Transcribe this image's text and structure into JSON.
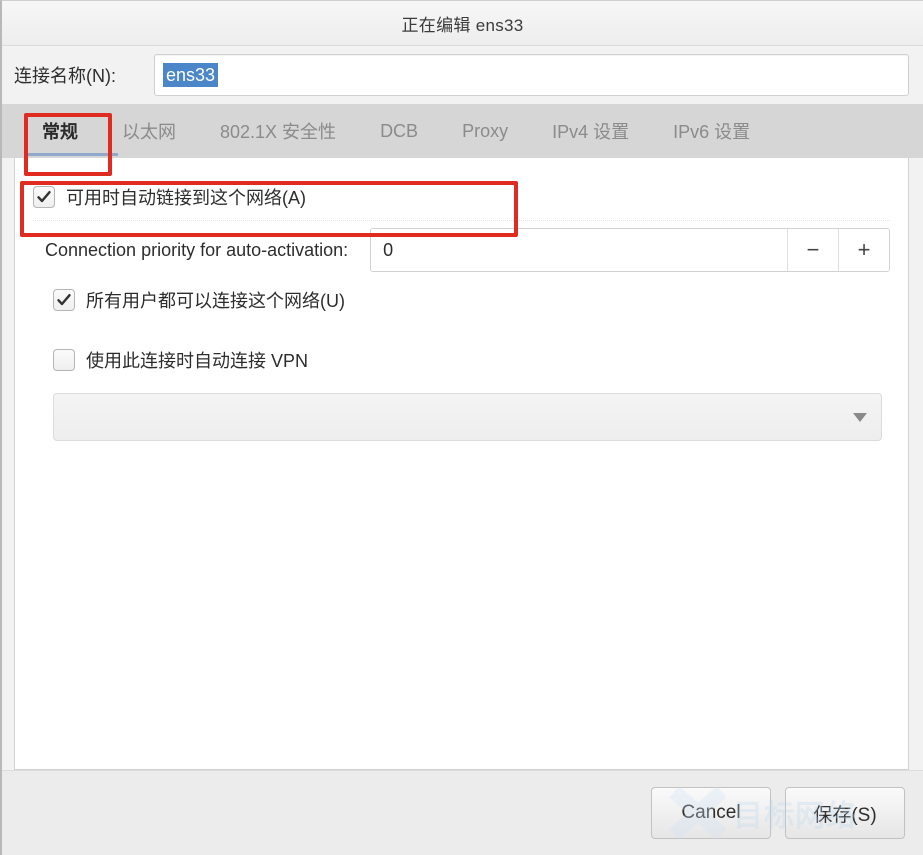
{
  "window": {
    "title": "正在编辑 ens33"
  },
  "name_row": {
    "label": "连接名称(N):",
    "value": "ens33",
    "placeholder": ""
  },
  "tabs": [
    {
      "label": "常规",
      "active": true
    },
    {
      "label": "以太网",
      "active": false
    },
    {
      "label": "802.1X 安全性",
      "active": false
    },
    {
      "label": "DCB",
      "active": false
    },
    {
      "label": "Proxy",
      "active": false
    },
    {
      "label": "IPv4 设置",
      "active": false
    },
    {
      "label": "IPv6 设置",
      "active": false
    }
  ],
  "general": {
    "autoconnect": {
      "label": "可用时自动链接到这个网络(A)",
      "checked": true
    },
    "priority": {
      "label": "Connection priority for auto-activation:",
      "value": "0",
      "minus_label": "−",
      "plus_label": "+"
    },
    "all_users": {
      "label": "所有用户都可以连接这个网络(U)",
      "checked": true
    },
    "auto_vpn": {
      "label": "使用此连接时自动连接 VPN",
      "checked": false
    },
    "vpn_dropdown": {
      "value": "",
      "icon": "chevron-down-icon"
    }
  },
  "footer": {
    "cancel_label": "Cancel",
    "save_label": "保存(S)"
  },
  "annotations": {
    "tab_highlight_color": "#e02b20",
    "checkbox_highlight_color": "#e02b20"
  },
  "watermark": {
    "text": "目标网络",
    "icon": "x-logo-icon"
  },
  "colors": {
    "selection_blue": "#4a86c8",
    "tabbar_gray": "#d6d6d6",
    "active_tab_underline": "#8fa8cc",
    "annotation_red": "#e02b20"
  }
}
